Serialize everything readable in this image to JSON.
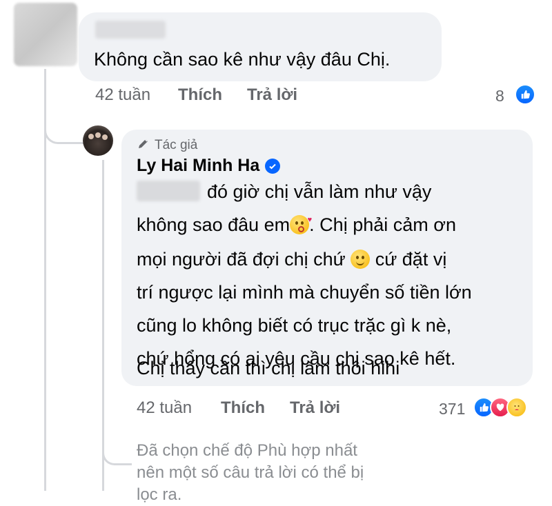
{
  "comment": {
    "text": "Không cần sao kê như vậy đâu Chị.",
    "time": "42 tuần",
    "like_label": "Thích",
    "reply_label": "Trả lời",
    "reaction_count": "8"
  },
  "reply": {
    "author_badge": "Tác giả",
    "author_name": "Ly Hai Minh Ha",
    "lines": [
      "đó giờ chị vẫn làm như vậy",
      "không sao đâu em",
      ". Chị phải cảm ơn",
      "mọi người đã đợi chị chứ",
      "cứ đặt vị",
      "trí ngược lại mình mà chuyển số tiền lớn",
      "cũng lo không biết có trục trặc gì k nè,",
      "chứ hổng có ai yêu cầu chị sao kê hết.",
      "Chị thấy cần thì chị làm thôi hihi"
    ],
    "time": "42 tuần",
    "like_label": "Thích",
    "reply_label": "Trả lời",
    "reaction_count": "371"
  },
  "filter_note": "Đã chọn chế độ Phù hợp nhất nên một số câu trả lời có thể bị lọc ra.",
  "colors": {
    "bubble": "#f0f2f5",
    "meta_text": "#65676b",
    "facebook_blue": "#0866ff",
    "love_red": "#e61e4d"
  },
  "icons": [
    "pencil-icon",
    "verified-badge-icon",
    "like-reaction-icon",
    "love-reaction-icon",
    "care-reaction-icon",
    "kiss-emoji-icon",
    "smile-emoji-icon"
  ]
}
